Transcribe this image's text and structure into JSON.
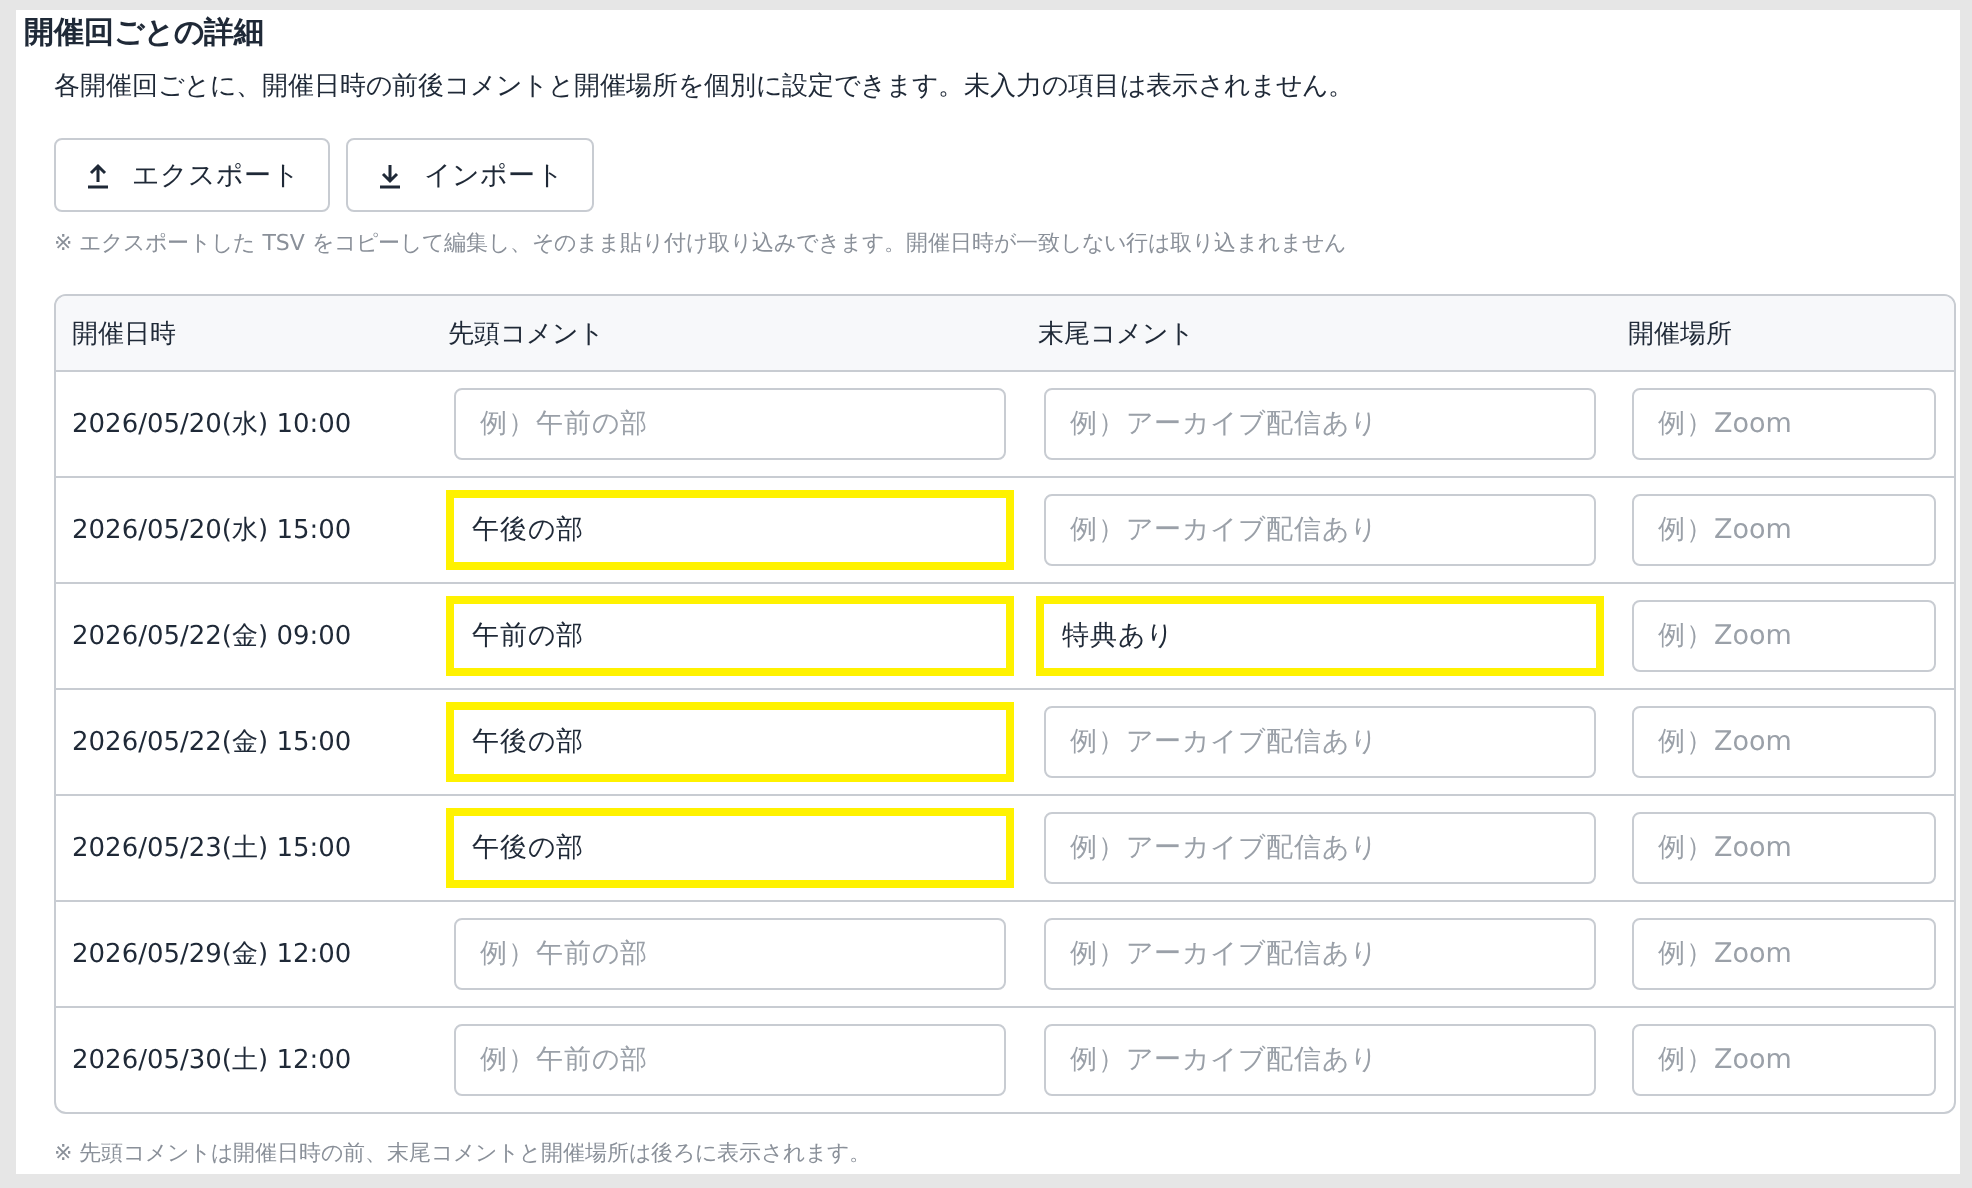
{
  "section": {
    "title": "開催回ごとの詳細",
    "description": "各開催回ごとに、開催日時の前後コメントと開催場所を個別に設定できます。未入力の項目は表示されません。"
  },
  "buttons": [
    {
      "kind": "export",
      "label": "エクスポート"
    },
    {
      "kind": "import",
      "label": "インポート"
    }
  ],
  "import_note": "※ エクスポートした TSV をコピーして編集し、そのまま貼り付け取り込みできます。開催日時が一致しない行は取り込まれません",
  "table": {
    "columns": [
      "開催日時",
      "先頭コメント",
      "末尾コメント",
      "開催場所"
    ],
    "rows": [
      {
        "cells": [
          {
            "kind": "text",
            "text": "2026/05/20(水) 10:00"
          },
          {
            "kind": "input",
            "placeholder": "例）午前の部",
            "highlighted": false
          },
          {
            "kind": "input",
            "placeholder": "例）アーカイブ配信あり",
            "highlighted": false
          },
          {
            "kind": "input",
            "placeholder": "例）Zoom",
            "highlighted": false
          }
        ]
      },
      {
        "cells": [
          {
            "kind": "text",
            "text": "2026/05/20(水) 15:00"
          },
          {
            "kind": "input",
            "value": "午後の部",
            "highlighted": true
          },
          {
            "kind": "input",
            "placeholder": "例）アーカイブ配信あり",
            "highlighted": false
          },
          {
            "kind": "input",
            "placeholder": "例）Zoom",
            "highlighted": false
          }
        ]
      },
      {
        "cells": [
          {
            "kind": "text",
            "text": "2026/05/22(金) 09:00"
          },
          {
            "kind": "input",
            "value": "午前の部",
            "highlighted": true
          },
          {
            "kind": "input",
            "value": "特典あり",
            "highlighted": true
          },
          {
            "kind": "input",
            "placeholder": "例）Zoom",
            "highlighted": false
          }
        ]
      },
      {
        "cells": [
          {
            "kind": "text",
            "text": "2026/05/22(金) 15:00"
          },
          {
            "kind": "input",
            "value": "午後の部",
            "highlighted": true
          },
          {
            "kind": "input",
            "placeholder": "例）アーカイブ配信あり",
            "highlighted": false
          },
          {
            "kind": "input",
            "placeholder": "例）Zoom",
            "highlighted": false
          }
        ]
      },
      {
        "cells": [
          {
            "kind": "text",
            "text": "2026/05/23(土) 15:00"
          },
          {
            "kind": "input",
            "value": "午後の部",
            "highlighted": true
          },
          {
            "kind": "input",
            "placeholder": "例）アーカイブ配信あり",
            "highlighted": false
          },
          {
            "kind": "input",
            "placeholder": "例）Zoom",
            "highlighted": false
          }
        ]
      },
      {
        "cells": [
          {
            "kind": "text",
            "text": "2026/05/29(金) 12:00"
          },
          {
            "kind": "input",
            "placeholder": "例）午前の部",
            "highlighted": false
          },
          {
            "kind": "input",
            "placeholder": "例）アーカイブ配信あり",
            "highlighted": false
          },
          {
            "kind": "input",
            "placeholder": "例）Zoom",
            "highlighted": false
          }
        ]
      },
      {
        "cells": [
          {
            "kind": "text",
            "text": "2026/05/30(土) 12:00"
          },
          {
            "kind": "input",
            "placeholder": "例）午前の部",
            "highlighted": false
          },
          {
            "kind": "input",
            "placeholder": "例）アーカイブ配信あり",
            "highlighted": false
          },
          {
            "kind": "input",
            "placeholder": "例）Zoom",
            "highlighted": false
          }
        ]
      }
    ]
  },
  "footer_note": "※ 先頭コメントは開催日時の前、末尾コメントと開催場所は後ろに表示されます。"
}
